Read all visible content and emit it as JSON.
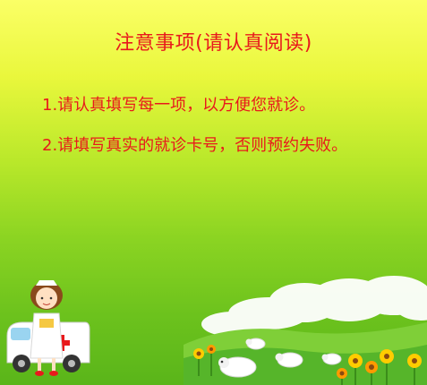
{
  "notice": {
    "title": "注意事项(请认真阅读)",
    "items": [
      "1.请认真填写每一项，以方便您就诊。",
      "2.请填写真实的就诊卡号，否则预约失败。"
    ]
  },
  "colors": {
    "text": "#e8191c",
    "background_top": "#fbff66",
    "background_bottom": "#5ab51a"
  },
  "icons": [
    "nurse-illustration",
    "ambulance-icon",
    "meadow-illustration",
    "sheep-icon",
    "sunflower-icon"
  ]
}
